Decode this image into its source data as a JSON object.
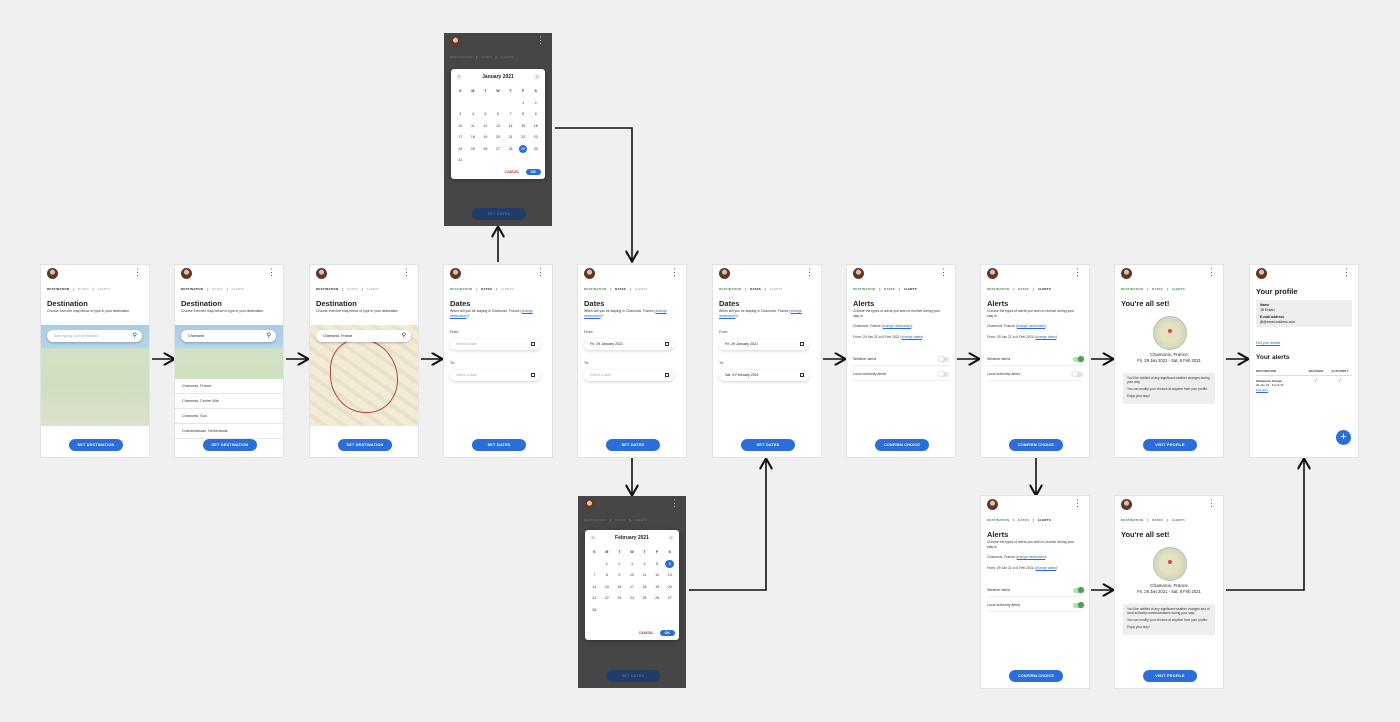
{
  "crumbs": {
    "destination": "DESTINATION",
    "dates": "DATES",
    "alerts": "ALERTS"
  },
  "destination": {
    "title": "Destination",
    "subtitle": "Choose from the map below or type in your destination",
    "search_placeholder": "Start typing your destination",
    "typed_value": "Chamonix",
    "selected_value": "Chamonix, France",
    "suggestions": [
      "Chamonix, France",
      "Chamonix, Centre Ville",
      "Chamonix, Sud",
      "Chamonixbaan, Netherlands"
    ],
    "button": "SET DESTINATION"
  },
  "dates": {
    "title": "Dates",
    "subtitle_prefix": "When will you be staying in Chamonix, France",
    "change_link": "change destination",
    "from_label": "From:",
    "to_label": "To:",
    "placeholder": "Select a date",
    "from_value": "Fri, 29 January 2021",
    "to_value": "Sat, 6 February 2021",
    "button": "SET DATES"
  },
  "calendar_jan": {
    "month": "January 2021",
    "weekdays": [
      "S",
      "M",
      "T",
      "W",
      "T",
      "F",
      "S"
    ],
    "lead_blanks": 5,
    "days": 31,
    "selected": 29,
    "cancel": "CANCEL",
    "ok": "OK"
  },
  "calendar_feb": {
    "month": "February 2021",
    "weekdays": [
      "S",
      "M",
      "T",
      "W",
      "T",
      "F",
      "S"
    ],
    "lead_blanks": 1,
    "days": 28,
    "selected": 6,
    "cancel": "CANCEL",
    "ok": "OK"
  },
  "alerts": {
    "title": "Alerts",
    "subtitle": "Choose the types of alerts you wish to receive during your stay in",
    "place": "Chamonix, France",
    "change_dest": "change destination",
    "dates_text": "From: 29 Jan 21 to 6 Feb 2021",
    "change_dates": "change dates",
    "weather": "Weather alerts",
    "authority": "Local authority alerts",
    "button": "CONFIRM CHOICE"
  },
  "all_set": {
    "title": "You're all set!",
    "place": "Chamonix, France",
    "dates": "Fri, 29 Jan 2021 - Sat, 6 Feb 2021",
    "note1_weather": "You'll be notified of any significant weather changes during your stay",
    "note1_both": "You'll be notified of any significant weather changes and of local authority communications during your stay.",
    "note2": "You can modify your choices at anytime from your profile.",
    "note3": "Enjoy your stay!",
    "button": "VISIT PROFILE"
  },
  "profile": {
    "title": "Your profile",
    "name_label": "Name",
    "name": "Jill Eckart",
    "email_label": "E-mail address",
    "email": "jill@email-address.com",
    "edit_details": "Edit your details",
    "alerts_title": "Your alerts",
    "col_dest": "DESTINATION",
    "col_weather": "WEATHER",
    "col_authority": "AUTHORITY",
    "row_place": "Chamonix, France",
    "row_dates": "29 Jan 21 - 6 Feb 21",
    "edit_alert": "Edit alert",
    "check": "✓",
    "fab": "+"
  }
}
